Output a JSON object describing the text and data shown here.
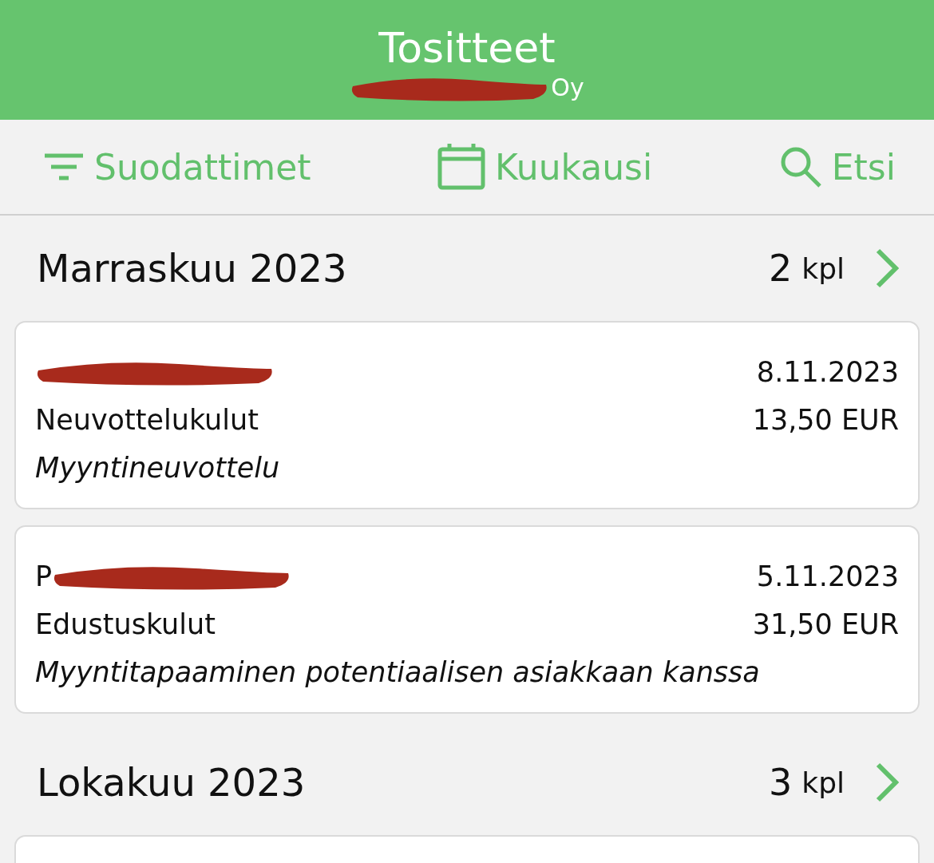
{
  "header": {
    "title": "Tositteet",
    "subtitle": "Oy"
  },
  "toolbar": [
    {
      "kind": "filter",
      "label": "Suodattimet"
    },
    {
      "kind": "calendar",
      "label": "Kuukausi"
    },
    {
      "kind": "search",
      "label": "Etsi"
    }
  ],
  "sections": [
    {
      "title": "Marraskuu 2023",
      "count": "2",
      "unit": "kpl",
      "items": [
        {
          "date": "8.11.2023",
          "category": "Neuvottelukulut",
          "amount": "13,50 EUR",
          "note": "Myyntineuvottelu"
        },
        {
          "name": "P",
          "date": "5.11.2023",
          "category": "Edustuskulut",
          "amount": "31,50 EUR",
          "note": "Myyntitapaaminen potentiaalisen asiakkaan kanssa"
        }
      ]
    },
    {
      "title": "Lokakuu 2023",
      "count": "3",
      "unit": "kpl"
    }
  ]
}
